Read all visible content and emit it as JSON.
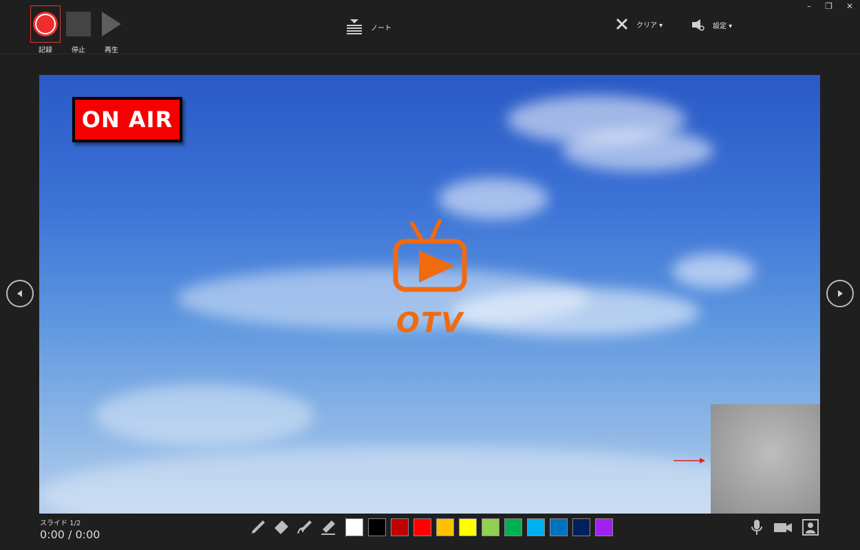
{
  "toolbar": {
    "record_label": "記録",
    "stop_label": "停止",
    "play_label": "再生",
    "notes_label": "ノート",
    "clear_label": "クリア ▾",
    "settings_label": "設定 ▾"
  },
  "window": {
    "minimize": "–",
    "restore": "❐",
    "close": "✕"
  },
  "slide": {
    "on_air": "ON AIR",
    "logo_text": "OTV"
  },
  "footer": {
    "slide_counter": "スライド 1/2",
    "time": "0:00  /  0:00"
  },
  "palette": {
    "colors": [
      "#ffffff",
      "#000000",
      "#c00000",
      "#ff0000",
      "#ffc000",
      "#ffff00",
      "#92d050",
      "#00b050",
      "#00b0f0",
      "#0070c0",
      "#002060",
      "#a020f0"
    ]
  },
  "icons": {
    "pen_tools": [
      "pen-icon",
      "eraser-icon",
      "highlighter-icon",
      "laser-pointer-icon"
    ],
    "right": [
      "microphone-icon",
      "camera-icon",
      "camera-preview-icon"
    ]
  },
  "accent_colors": {
    "record": "#ef2d2d",
    "logo": "#f06a10",
    "on_air_bg": "#f40000"
  }
}
